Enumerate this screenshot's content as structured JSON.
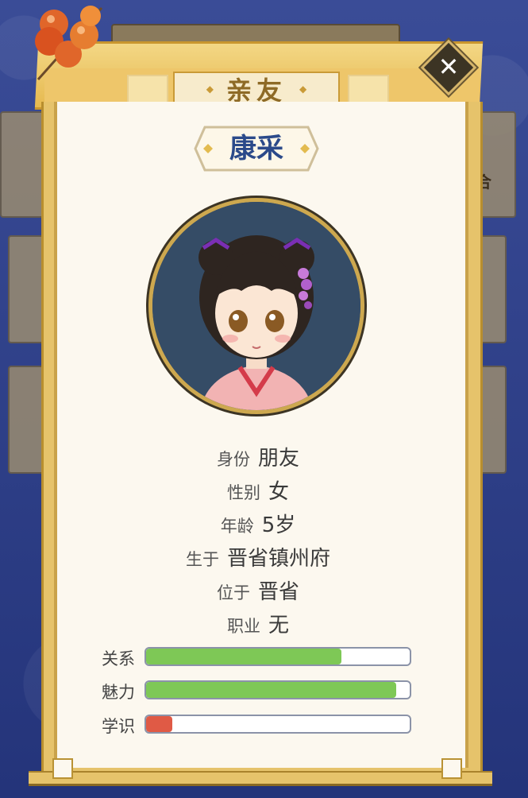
{
  "header": {
    "title": "亲友"
  },
  "friend": {
    "name": "康采",
    "info": [
      {
        "label": "身份",
        "value": "朋友"
      },
      {
        "label": "性别",
        "value": "女"
      },
      {
        "label": "年龄",
        "value": "5岁"
      },
      {
        "label": "生于",
        "value": "晋省镇州府"
      },
      {
        "label": "位于",
        "value": "晋省"
      },
      {
        "label": "职业",
        "value": "无"
      }
    ],
    "stats": [
      {
        "label": "关系",
        "fraction": 0.74,
        "color": "#7ec856"
      },
      {
        "label": "魅力",
        "fraction": 0.95,
        "color": "#7ec856"
      },
      {
        "label": "学识",
        "fraction": 0.1,
        "color": "#e05a45"
      }
    ]
  },
  "background": {
    "side_text": "合"
  },
  "colors": {
    "accent_gold": "#e6c36b",
    "name_blue": "#2b4a8a",
    "bar_green": "#7ec856",
    "bar_red": "#e05a45"
  },
  "icons": {
    "close": "close-icon",
    "decoration": "candied-hawthorn-icon"
  }
}
